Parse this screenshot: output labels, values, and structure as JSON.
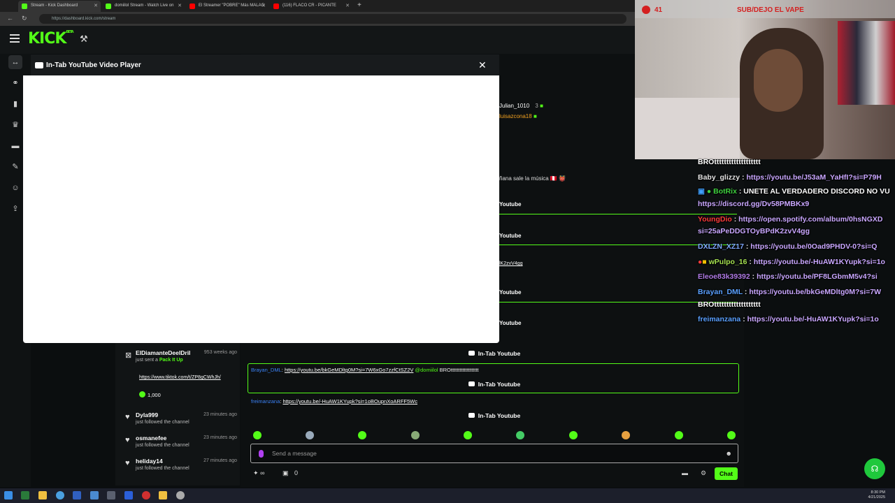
{
  "browser": {
    "tabs": [
      {
        "label": "Stream - Kick Dashboard",
        "color": "#53fc18"
      },
      {
        "label": "domiilol Stream - Watch Live on",
        "color": "#53fc18"
      },
      {
        "label": "El Streamer \"POBRE\" Más MALAG",
        "color": "#ff0000"
      },
      {
        "label": "(116) FLACO CR - PICANTE",
        "color": "#ff0000"
      }
    ],
    "url": "https://dashboard.kick.com/stream",
    "new_tab": "+"
  },
  "header": {
    "logo": "KICK",
    "logo_tag": "BETA"
  },
  "rail": {
    "icons": [
      "broadcast-icon",
      "link-icon",
      "chart-icon",
      "trophy-icon",
      "card-icon",
      "wrench-icon",
      "users-icon",
      "upload-icon"
    ]
  },
  "modal": {
    "title": "In-Tab YouTube Video Player",
    "close": "✕"
  },
  "behind_modal": {
    "users": [
      {
        "name": "Julian_1010",
        "count": "3"
      },
      {
        "name": "luisazcona18",
        "count": ""
      }
    ],
    "fragments": [
      "ñana sale la música 🇵🇪 👹",
      "Youtube",
      "Youtube",
      "lK2zvV4gg",
      "Youtube",
      "Youtube"
    ]
  },
  "alerts": [
    {
      "icon": "kick-icon",
      "name": "ElDiamanteDeelDril",
      "time": "953 weeks ago",
      "action_prefix": "just sent a ",
      "action_highlight": "Pack It Up",
      "link": "https://www.tiktok.com/t/ZP8gCWhJh/",
      "amount": "1,000"
    },
    {
      "icon": "heart-icon",
      "name": "Dyla999",
      "time": "23 minutes ago",
      "action": "just followed the channel"
    },
    {
      "icon": "heart-icon",
      "name": "osmanefee",
      "time": "23 minutes ago",
      "action": "just followed the channel"
    },
    {
      "icon": "heart-icon",
      "name": "heliday14",
      "time": "27 minutes ago",
      "action": "just followed the channel"
    }
  ],
  "chat": {
    "yt_label": "In-Tab Youtube",
    "messages": [
      {
        "user": "Brayan_DML",
        "sep": ": ",
        "link": "https://youtu.be/bkGeMDltg0M?si=7W6xGo7zzfCtSZ2V",
        "mention": "@domiilol",
        "text": "BROttttttttttttttttttt"
      },
      {
        "user": "freimanzana",
        "sep": ": ",
        "link": "https://youtu.be/-HuAW1KYupk?si=1oBOupnXoARFF5Wc",
        "mention": "",
        "text": ""
      }
    ],
    "input_placeholder": "Send a message",
    "footer_left": "∞",
    "footer_gift": "0",
    "chat_button": "Chat"
  },
  "webcam": {
    "viewer_count": "41",
    "goal_text": "SUB/DEJO EL VAPE"
  },
  "overlay_chat": [
    {
      "name": "",
      "color": "#ffffff",
      "msg": "BROttttttttttttttttttt"
    },
    {
      "name": "Baby_glizzy",
      "color": "#e3e3e3",
      "msg": "https://youtu.be/J53aM_YaHfI?si=P79H"
    },
    {
      "name": "BotRix",
      "color": "#3fd13f",
      "msg": "UNETE AL VERDADERO DISCORD NO VU"
    },
    {
      "name": "",
      "color": "#ffffff",
      "msg": "https://discord.gg/Dv58PMBKx9"
    },
    {
      "name": "YoungDio",
      "color": "#ff3b3b",
      "msg": "https://open.spotify.com/album/0hsNGXD"
    },
    {
      "name": "",
      "color": "#ffffff",
      "msg": "si=25aPeDDGTOyBPdK2zvV4gg"
    },
    {
      "name": "DXLZN_XZ17",
      "color": "#7fa8ff",
      "msg": "https://youtu.be/0Oad9PHDV-0?si=Q"
    },
    {
      "name": "wPulpo_16",
      "color": "#a4e050",
      "msg": "https://youtu.be/-HuAW1KYupk?si=1o"
    },
    {
      "name": "Eleoe83k39392",
      "color": "#b07be6",
      "msg": "https://youtu.be/PF8LGbmM5v4?si"
    },
    {
      "name": "Brayan_DML",
      "color": "#5aa0ff",
      "msg": "https://youtu.be/bkGeMDltg0M?si=7W"
    },
    {
      "name": "",
      "color": "#ffffff",
      "msg": "BROttttttttttttttttttt"
    },
    {
      "name": "freimanzana",
      "color": "#5aa0ff",
      "msg": "https://youtu.be/-HuAW1KYupk?si=1o"
    }
  ],
  "taskbar": {
    "time": "8:30 PM",
    "date": "4/21/2025"
  }
}
